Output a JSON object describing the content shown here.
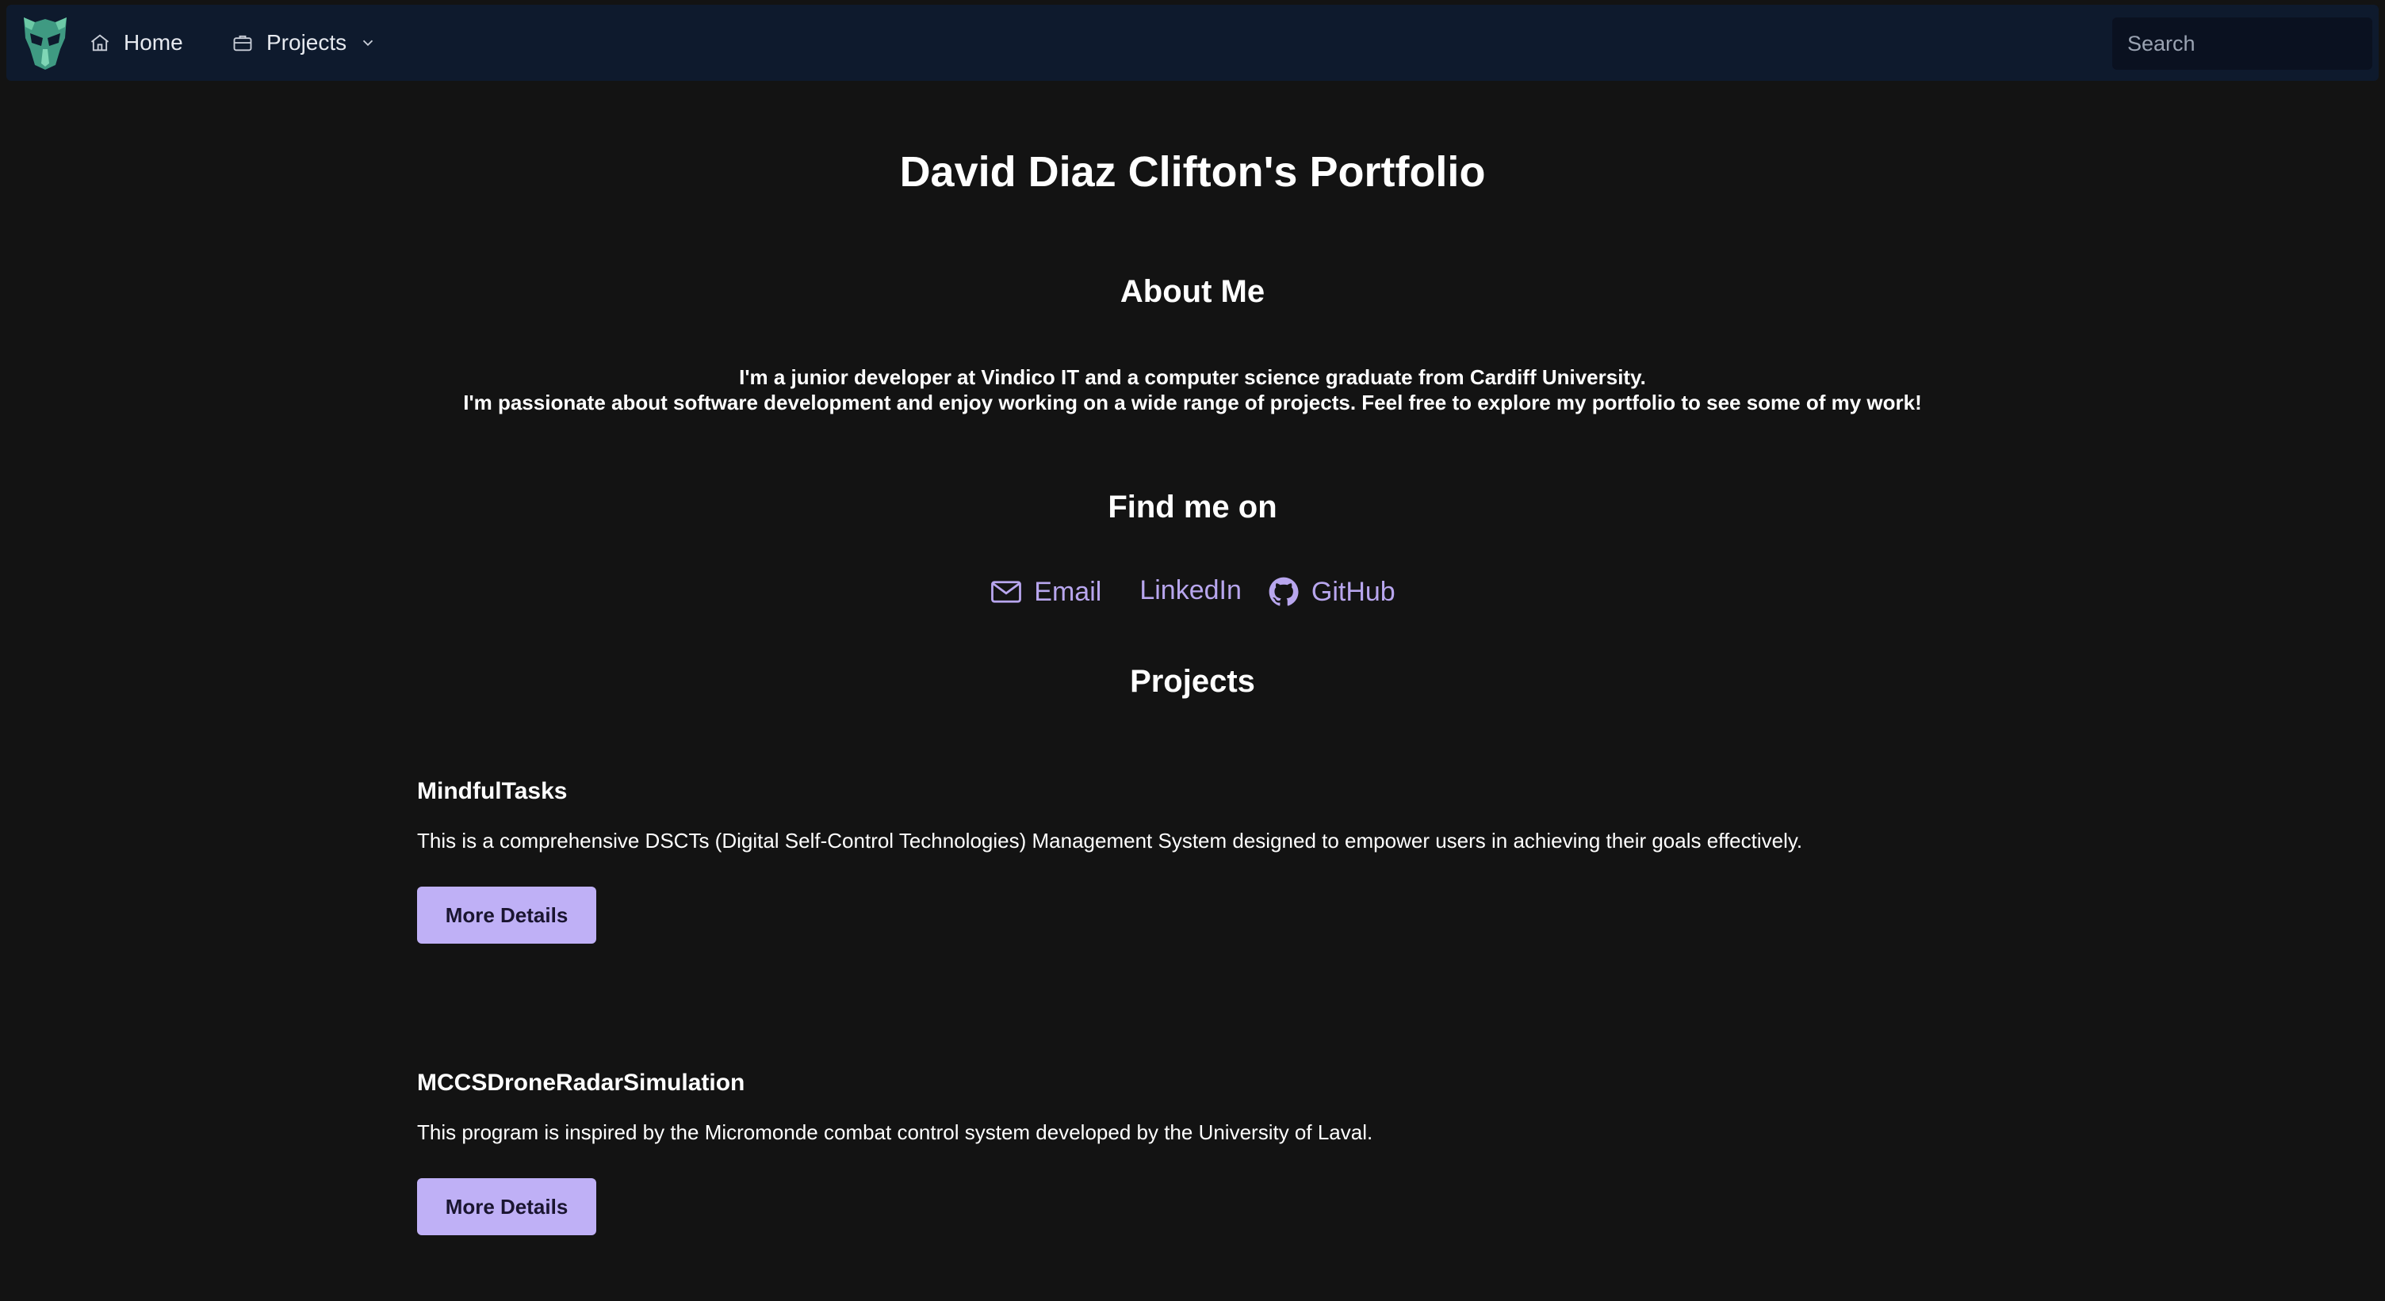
{
  "nav": {
    "logo_icon": "robot-mask-logo",
    "home_label": "Home",
    "projects_label": "Projects",
    "search_placeholder": "Search"
  },
  "header": {
    "title": "David Diaz Clifton's Portfolio"
  },
  "about": {
    "title": "About Me",
    "line1": "I'm a junior developer at Vindico IT and a computer science graduate from Cardiff University.",
    "line2": "I'm passionate about software development and enjoy working on a wide range of projects. Feel free to explore my portfolio to see some of my work!"
  },
  "find_me": {
    "title": "Find me on",
    "links": [
      {
        "label": "Email",
        "icon": "mail-icon"
      },
      {
        "label": "LinkedIn",
        "icon": ""
      },
      {
        "label": "GitHub",
        "icon": "github-icon"
      }
    ]
  },
  "projects": {
    "title": "Projects",
    "items": [
      {
        "name": "MindfulTasks",
        "description": "This is a comprehensive DSCTs (Digital Self-Control Technologies) Management System designed to empower users in achieving their goals effectively.",
        "button_label": "More Details"
      },
      {
        "name": "MCCSDroneRadarSimulation",
        "description": "This program is inspired by the Micromonde combat control system developed by the University of Laval.",
        "button_label": "More Details"
      }
    ]
  },
  "colors": {
    "background": "#131313",
    "navbar": "#0e1a2d",
    "link": "#b8a6ee",
    "button": "#bfb0f6"
  }
}
